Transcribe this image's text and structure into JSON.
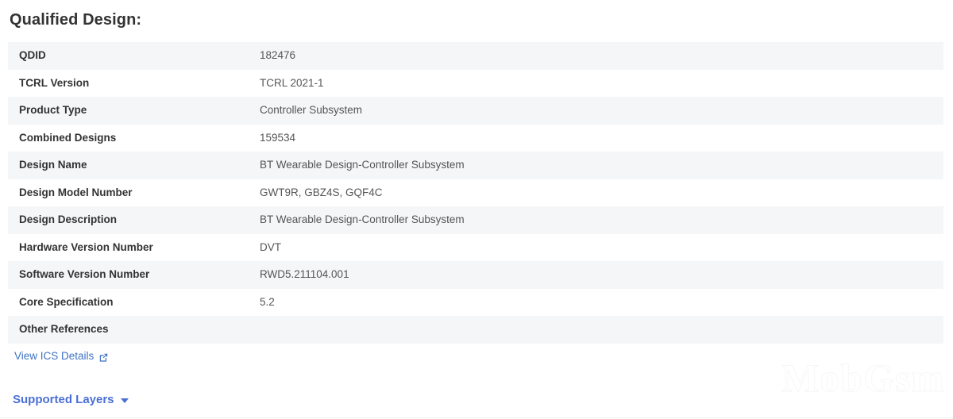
{
  "page_title": "Qualified Design:",
  "colors": {
    "link_blue": "#3f72c4",
    "heading_blue": "#4a6fd4",
    "stripe": "#f5f6f7",
    "text_dark": "#333333",
    "text_value": "#555555"
  },
  "table": {
    "rows": [
      {
        "label": "QDID",
        "value": "182476"
      },
      {
        "label": "TCRL Version",
        "value": "TCRL 2021-1"
      },
      {
        "label": "Product Type",
        "value": "Controller Subsystem"
      },
      {
        "label": "Combined Designs",
        "value": "159534"
      },
      {
        "label": "Design Name",
        "value": "BT Wearable Design-Controller Subsystem"
      },
      {
        "label": "Design Model Number",
        "value": "GWT9R, GBZ4S, GQF4C"
      },
      {
        "label": "Design Description",
        "value": "BT Wearable Design-Controller Subsystem"
      },
      {
        "label": "Hardware Version Number",
        "value": "DVT"
      },
      {
        "label": "Software Version Number",
        "value": "RWD5.211104.001"
      },
      {
        "label": "Core Specification",
        "value": "5.2"
      },
      {
        "label": "Other References",
        "value": ""
      }
    ]
  },
  "ics_link": {
    "label": "View ICS Details",
    "icon": "external-link-icon"
  },
  "supported_layers": {
    "label": "Supported Layers",
    "icon": "chevron-down-icon"
  },
  "watermark": {
    "text": "MobGsm"
  }
}
